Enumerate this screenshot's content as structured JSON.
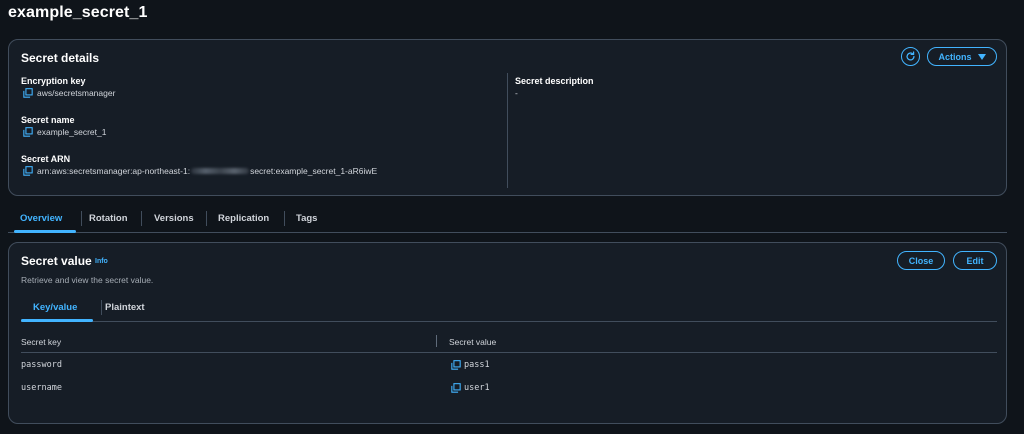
{
  "page": {
    "title": "example_secret_1"
  },
  "details": {
    "title": "Secret details",
    "actions_label": "Actions",
    "encryption_key_label": "Encryption key",
    "encryption_key_value": "aws/secretsmanager",
    "secret_name_label": "Secret name",
    "secret_name_value": "example_secret_1",
    "secret_arn_label": "Secret ARN",
    "secret_arn_prefix": "arn:aws:secretsmanager:ap-northeast-1:",
    "secret_arn_suffix": "secret:example_secret_1-aR6iwE",
    "secret_description_label": "Secret description",
    "secret_description_value": "-"
  },
  "tabs": [
    {
      "label": "Overview",
      "active": true
    },
    {
      "label": "Rotation",
      "active": false
    },
    {
      "label": "Versions",
      "active": false
    },
    {
      "label": "Replication",
      "active": false
    },
    {
      "label": "Tags",
      "active": false
    }
  ],
  "secret_value": {
    "title": "Secret value",
    "info_label": "Info",
    "subtitle": "Retrieve and view the secret value.",
    "close_label": "Close",
    "edit_label": "Edit",
    "inner_tabs": [
      {
        "label": "Key/value",
        "active": true
      },
      {
        "label": "Plaintext",
        "active": false
      }
    ],
    "columns": [
      "Secret key",
      "Secret value"
    ],
    "rows": [
      {
        "key": "password",
        "value": "pass1"
      },
      {
        "key": "username",
        "value": "user1"
      }
    ]
  },
  "colors": {
    "background": "#0f141a",
    "panel": "#161d26",
    "border": "#414d5c",
    "accent": "#42b4ff",
    "text": "#d1d5db"
  },
  "icons": [
    "copy-icon",
    "refresh-icon",
    "caret-down-icon"
  ]
}
